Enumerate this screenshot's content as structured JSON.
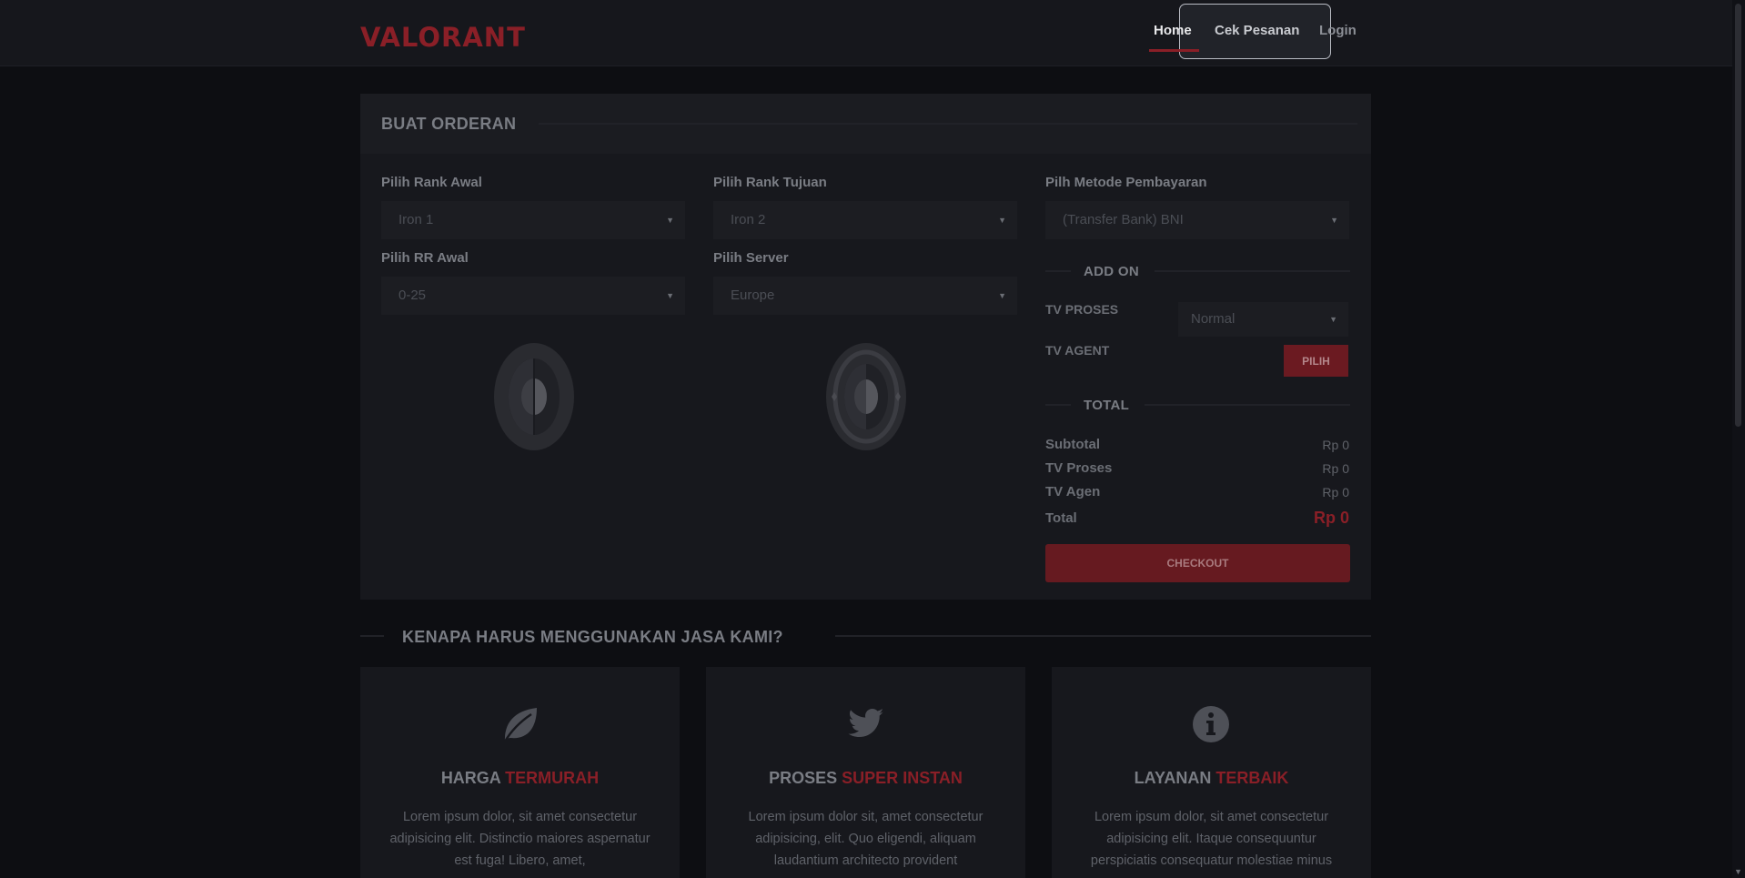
{
  "nav": {
    "logo": "VALORANT",
    "links": [
      "Home",
      "Cek Pesanan",
      "Login"
    ]
  },
  "order": {
    "title": "BUAT ORDERAN",
    "rank_awal": {
      "label": "Pilih Rank Awal",
      "value": "Iron 1"
    },
    "rank_tujuan": {
      "label": "Pilih Rank Tujuan",
      "value": "Iron 2"
    },
    "metode": {
      "label": "Pilh Metode Pembayaran",
      "value": "(Transfer Bank) BNI"
    },
    "rr_awal": {
      "label": "Pilih RR Awal",
      "value": "0-25"
    },
    "server": {
      "label": "Pilih Server",
      "value": "Europe"
    },
    "addon": {
      "title": "ADD ON",
      "tv_proses_label": "TV PROSES",
      "tv_proses_value": "Normal",
      "tv_agent_label": "TV AGENT",
      "pilih_label": "PILIH"
    },
    "total": {
      "title": "TOTAL",
      "rows": [
        {
          "label": "Subtotal",
          "value": "Rp 0"
        },
        {
          "label": "TV Proses",
          "value": "Rp 0"
        },
        {
          "label": "TV Agen",
          "value": "Rp 0"
        }
      ],
      "total_label": "Total",
      "total_value": "Rp 0"
    },
    "checkout_label": "CHECKOUT"
  },
  "why": {
    "title": "KENAPA HARUS MENGGUNAKAN JASA KAMI?",
    "cards": [
      {
        "icon": "leaf-icon",
        "title_plain": "HARGA",
        "title_accent": "TERMURAH",
        "text": "Lorem ipsum dolor, sit amet consectetur adipisicing elit. Distinctio maiores aspernatur est fuga! Libero, amet,"
      },
      {
        "icon": "twitter-icon",
        "title_plain": "PROSES",
        "title_accent": "SUPER INSTAN",
        "text": "Lorem ipsum dolor sit, amet consectetur adipisicing, elit. Quo eligendi, aliquam laudantium architecto provident"
      },
      {
        "icon": "info-icon",
        "title_plain": "LAYANAN",
        "title_accent": "TERBAIK",
        "text": "Lorem ipsum dolor, sit amet consectetur adipisicing elit. Itaque consequuntur perspiciatis consequatur molestiae minus"
      }
    ]
  },
  "colors": {
    "accent": "#8a1f27",
    "background": "#0d0e12",
    "panel": "#17181d"
  }
}
